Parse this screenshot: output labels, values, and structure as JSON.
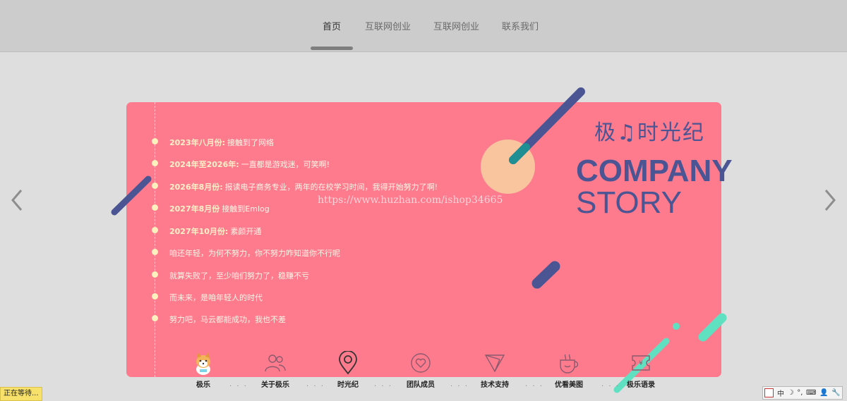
{
  "nav": {
    "items": [
      "首页",
      "互联网创业",
      "互联网创业",
      "联系我们"
    ]
  },
  "timeline": [
    {
      "date": "2023年八月份:",
      "text": "接触到了网络"
    },
    {
      "date": "2024年至2026年:",
      "text": "一直都是游戏迷，可笑啊!"
    },
    {
      "date": "2026年8月份:",
      "text": "报读电子商务专业，两年的在校学习时间，我得开始努力了啊!"
    },
    {
      "date": "2027年8月份",
      "text": "接触到Emlog"
    },
    {
      "date": "2027年10月份:",
      "text": "素颜开通"
    },
    {
      "date": "",
      "text": "咱还年轻，为何不努力，你不努力咋知道你不行呢"
    },
    {
      "date": "",
      "text": "就算失败了，至少咱们努力了，稳赚不亏"
    },
    {
      "date": "",
      "text": "而未来，是咱年轻人的时代"
    },
    {
      "date": "",
      "text": "努力吧，马云都能成功，我也不差"
    }
  ],
  "brand": {
    "name": "极♫时光纪",
    "line1": "COMPANY",
    "line2": "STORY"
  },
  "watermark": "https://www.huzhan.com/ishop34665",
  "bottom_nav": [
    {
      "label": "极乐",
      "icon": "dog-mascot-icon"
    },
    {
      "label": "关于极乐",
      "icon": "users-icon"
    },
    {
      "label": "时光纪",
      "icon": "location-pin-icon"
    },
    {
      "label": "团队成员",
      "icon": "heart-icon"
    },
    {
      "label": "技术支持",
      "icon": "send-icon"
    },
    {
      "label": "优看美图",
      "icon": "coffee-cup-icon"
    },
    {
      "label": "极乐语录",
      "icon": "ticket-icon"
    }
  ],
  "status_text": "正在等待...",
  "ime": {
    "items": [
      "中",
      "☽",
      "°,",
      "⌨",
      "👤",
      "🔧"
    ]
  },
  "colors": {
    "card": "#fe7b8e",
    "accent": "#4b5593",
    "teal": "#5fe0c0",
    "peach": "#f9c59f"
  }
}
